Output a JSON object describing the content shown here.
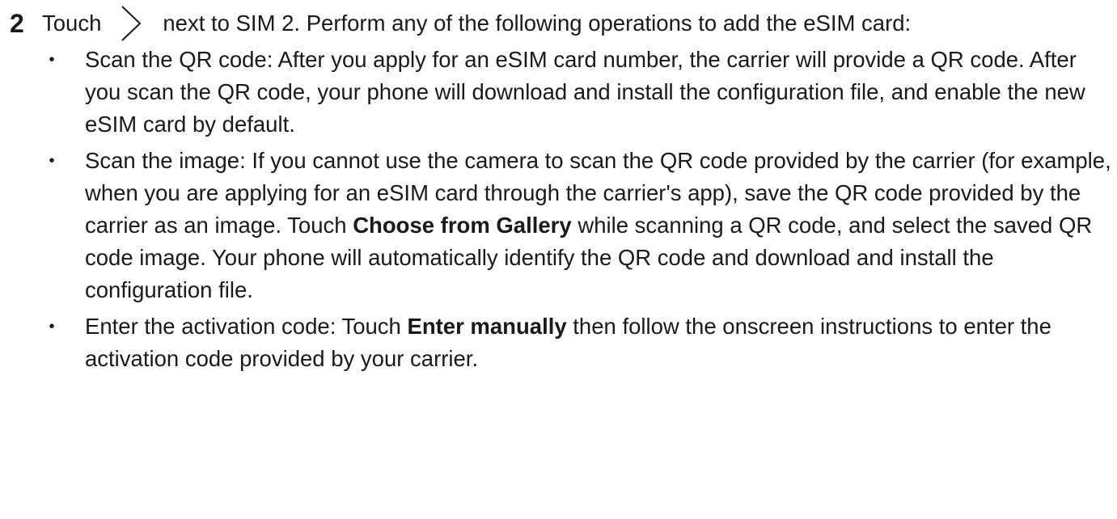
{
  "step": {
    "number": "2",
    "before_icon": "Touch",
    "icon": "chevron-right-icon",
    "after_icon": "next to SIM 2. Perform any of the following operations to add the eSIM card:"
  },
  "bullets": [
    {
      "text": "Scan the QR code: After you apply for an eSIM card number, the carrier will provide a QR code. After you scan the QR code, your phone will download and install the configuration file, and enable the new eSIM card by default."
    },
    {
      "text_before": "Scan the image: If you cannot use the camera to scan the QR code provided by the carrier (for example, when you are applying for an eSIM card through the carrier's app), save the QR code provided by the carrier as an image. Touch ",
      "bold": "Choose from Gallery",
      "text_after": " while scanning a QR code, and select the saved QR code image. Your phone will automatically identify the QR code and download and install the configuration file."
    },
    {
      "text_before": "Enter the activation code: Touch ",
      "bold": "Enter manually",
      "text_after": " then follow the onscreen instructions to enter the activation code provided by your carrier."
    }
  ]
}
